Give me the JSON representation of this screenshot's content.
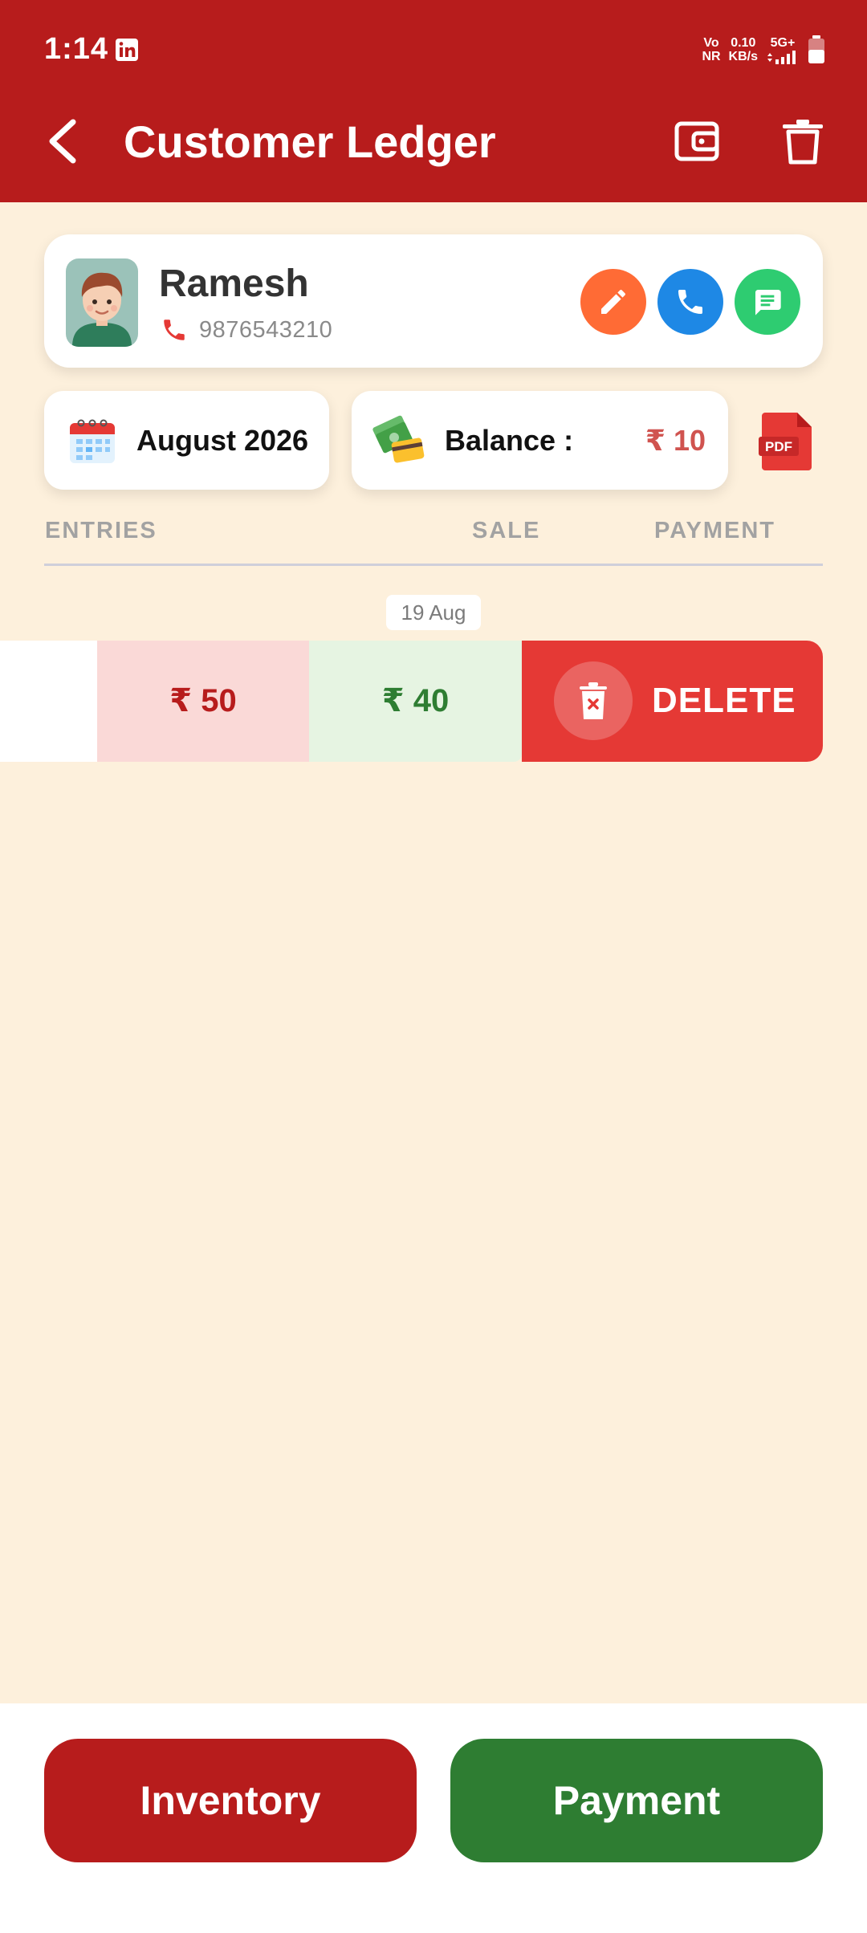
{
  "status_bar": {
    "time": "1:14",
    "net_top": "Vo",
    "net_bottom": "NR",
    "speed_value": "0.10",
    "speed_unit": "KB/s",
    "signal": "5G+"
  },
  "app_bar": {
    "title": "Customer Ledger"
  },
  "customer": {
    "name": "Ramesh",
    "phone": "9876543210"
  },
  "summary": {
    "month": "August 2026",
    "balance_label": "Balance :",
    "balance_value": "₹ 10"
  },
  "columns": {
    "entries": "ENTRIES",
    "sale": "SALE",
    "payment": "PAYMENT"
  },
  "entries": [
    {
      "date": "19 Aug",
      "sale": "₹ 50",
      "payment": "₹ 40",
      "delete_label": "DELETE"
    }
  ],
  "bottom": {
    "inventory_label": "Inventory",
    "payment_label": "Payment"
  },
  "pdf_label": "PDF",
  "colors": {
    "primary": "#B71C1C",
    "background": "#FDF0DC",
    "sale_bg": "#FAD9D7",
    "payment_bg": "#E6F4E2",
    "delete": "#E53935",
    "green": "#2E7D32",
    "edit": "#FF6B35",
    "call": "#1E88E5",
    "message": "#2ECC71"
  },
  "icons": {
    "back": "back-arrow-icon",
    "wallet": "wallet-icon",
    "delete": "trash-icon",
    "edit": "pencil-icon",
    "call": "phone-icon",
    "message": "chat-icon",
    "calendar": "calendar-icon",
    "money": "money-card-icon",
    "pdf": "pdf-icon"
  }
}
